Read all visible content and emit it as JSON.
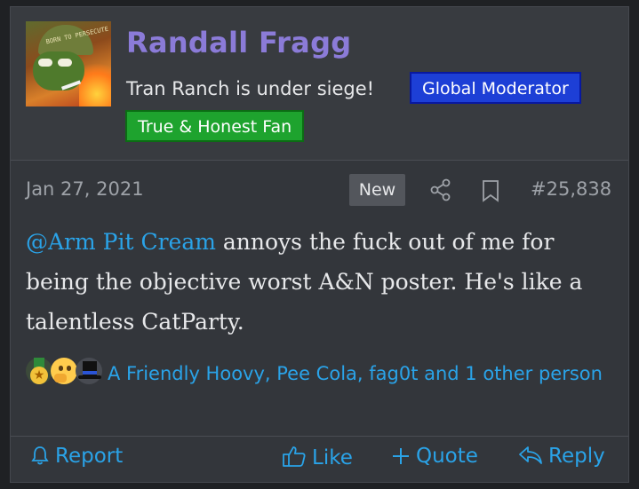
{
  "user": {
    "name": "Randall Fragg",
    "title": "Tran Ranch is under siege!",
    "badges": [
      "Global Moderator",
      "True & Honest Fan"
    ],
    "avatar_helmet_text": "BORN TO PERSECUTE"
  },
  "post": {
    "date": "Jan 27, 2021",
    "new_label": "New",
    "number": "#25,838",
    "mention": "@Arm Pit Cream",
    "body": " annoys the fuck out of me for being the objective worst A&N poster. He's like a talentless CatParty."
  },
  "reactions": {
    "icons": [
      "medal-icon",
      "thinking-face-icon",
      "top-hat-icon"
    ],
    "text": "A Friendly Hoovy, Pee Cola, fag0t and 1 other person"
  },
  "actions": {
    "report": "Report",
    "like": "Like",
    "quote": "Quote",
    "reply": "Reply"
  },
  "colors": {
    "username": "#8b7bd8",
    "link": "#2aa3e8",
    "moderator_badge": "#1d3fd6",
    "fan_badge": "#1ea32e"
  }
}
